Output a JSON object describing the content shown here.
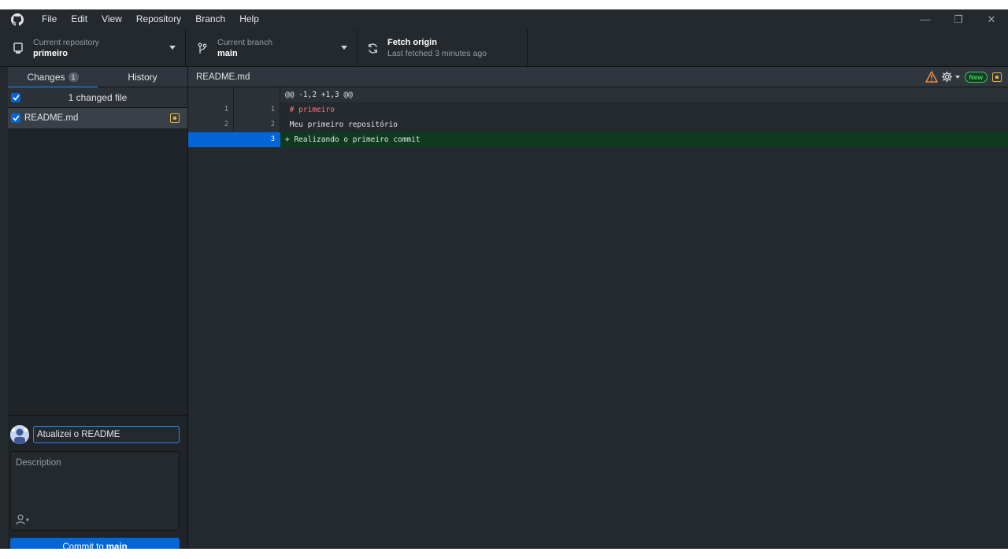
{
  "menu": [
    "File",
    "Edit",
    "View",
    "Repository",
    "Branch",
    "Help"
  ],
  "window_controls": {
    "minimize": "—",
    "restore": "❐",
    "close": "✕"
  },
  "toolbar": {
    "repo": {
      "sub": "Current repository",
      "main": "primeiro"
    },
    "branch": {
      "sub": "Current branch",
      "main": "main"
    },
    "fetch": {
      "main": "Fetch origin",
      "sub": "Last fetched 3 minutes ago"
    }
  },
  "sidebar": {
    "tabs": {
      "changes": "Changes",
      "changes_count": "1",
      "history": "History"
    },
    "changed_header": "1 changed file",
    "files": [
      {
        "name": "README.md",
        "status": "modified"
      }
    ]
  },
  "commit": {
    "summary_value": "Atualizei o README",
    "description_placeholder": "Description",
    "button_prefix": "Commit to",
    "button_branch": "main"
  },
  "diff": {
    "file_title": "README.md",
    "new_badge": "New",
    "hunk": "@@ -1,2 +1,3 @@",
    "lines": [
      {
        "old": "1",
        "new": "1",
        "text": " # primeiro"
      },
      {
        "old": "2",
        "new": "2",
        "text": " Meu primeiro repositório"
      },
      {
        "old": "",
        "new": "3",
        "text": "+ Realizando o primeiro commit"
      }
    ]
  },
  "colors": {
    "accent": "#0366d6",
    "added_bg": "#0f3a1f",
    "warning": "#e3b341",
    "new_badge": "#34d058"
  }
}
